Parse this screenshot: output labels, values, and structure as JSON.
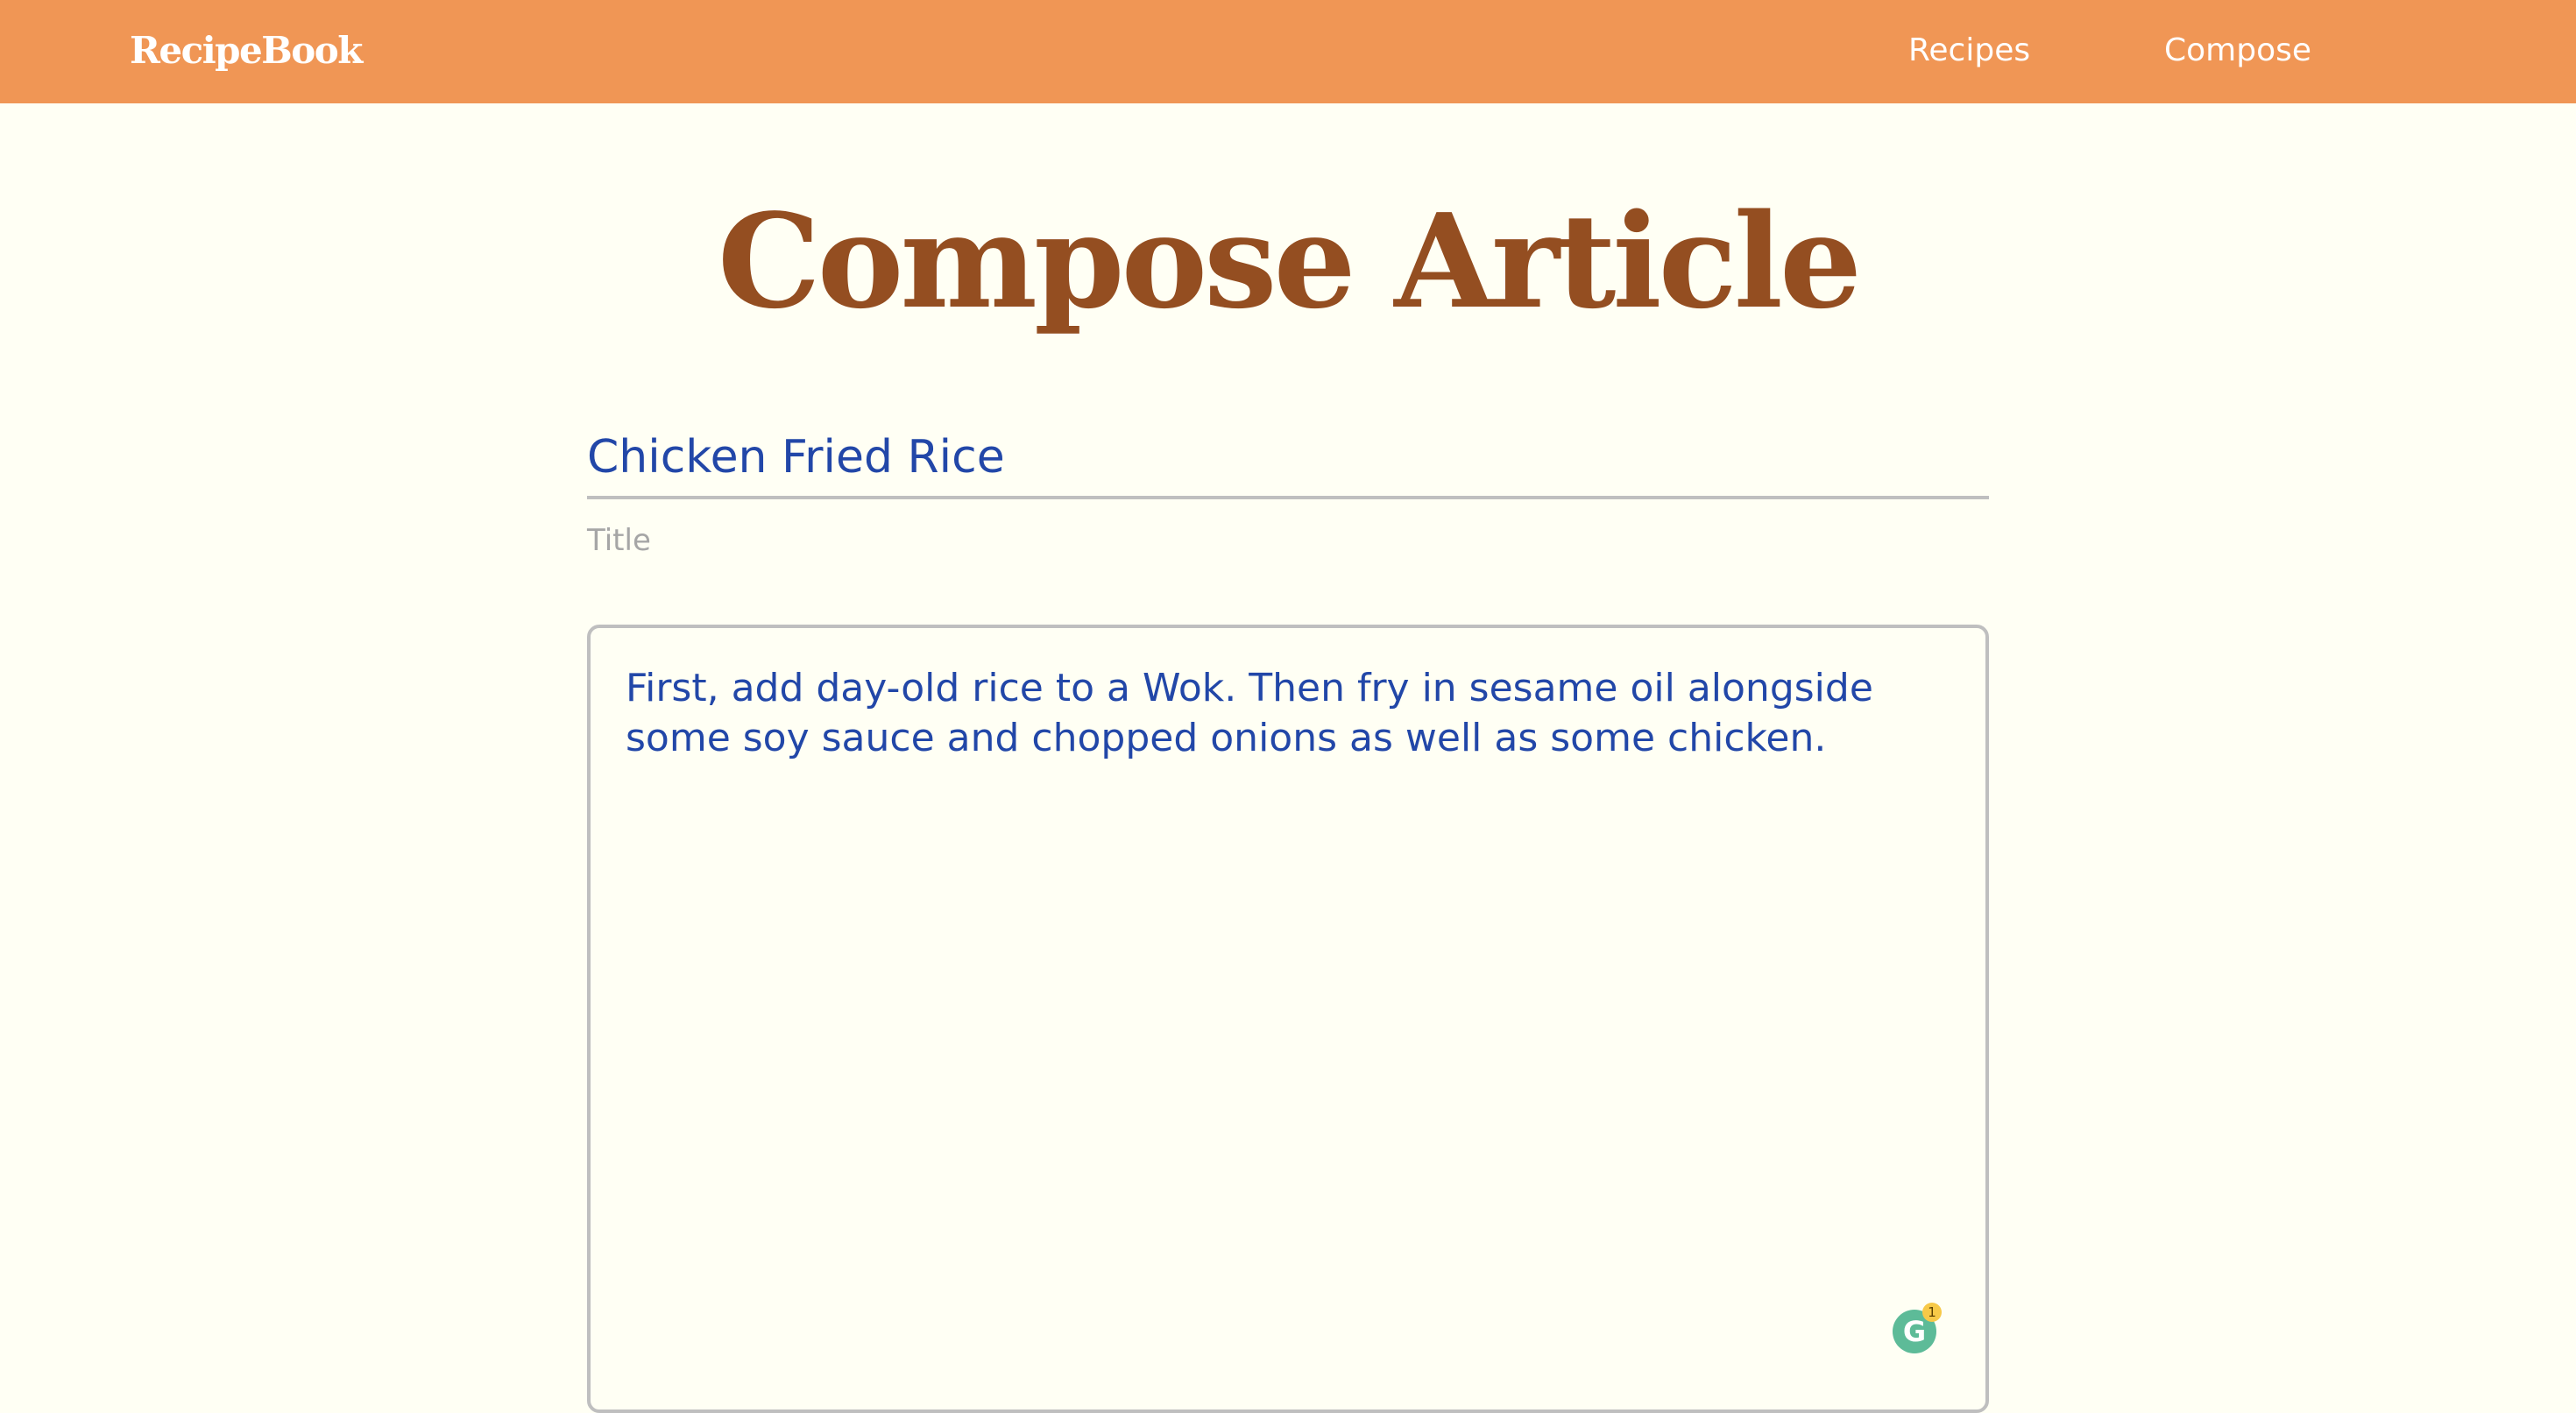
{
  "header": {
    "brand": "RecipeBook",
    "nav": [
      {
        "label": "Recipes"
      },
      {
        "label": "Compose"
      }
    ]
  },
  "main": {
    "page_title": "Compose Article",
    "title_field": {
      "value": "Chicken Fried Rice",
      "helper_text": "Title"
    },
    "body_field": {
      "value": "First, add day-old rice to a Wok. Then fry in sesame oil alongside some soy sauce and chopped onions as well as some chicken."
    },
    "grammarly": {
      "icon": "grammarly-icon",
      "letter": "G",
      "badge_count": "1"
    }
  },
  "colors": {
    "header_bg": "#F09655",
    "page_bg": "#FFFFF4",
    "title_color": "#944E21",
    "text_blue": "#2247A8",
    "border_gray": "#BFBFBF"
  }
}
